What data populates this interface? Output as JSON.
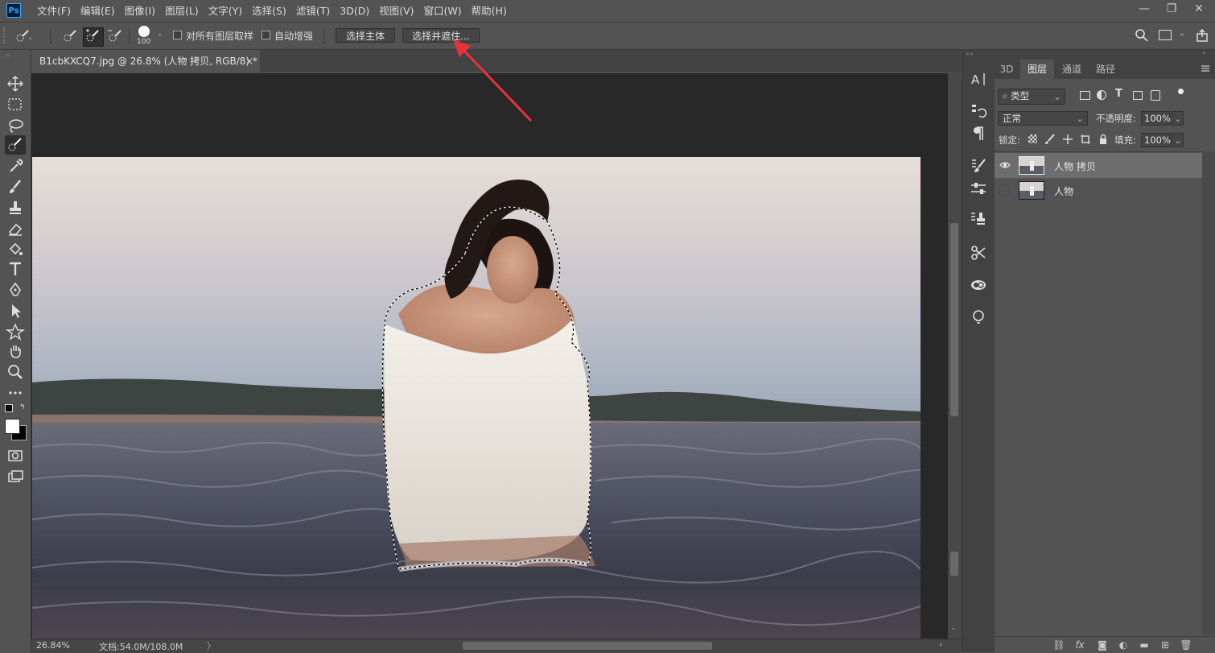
{
  "app": {
    "logo_text": "Ps"
  },
  "menu": [
    "文件(F)",
    "编辑(E)",
    "图像(I)",
    "图层(L)",
    "文字(Y)",
    "选择(S)",
    "滤镜(T)",
    "3D(D)",
    "视图(V)",
    "窗口(W)",
    "帮助(H)"
  ],
  "window_controls": {
    "minimize": "—",
    "restore": "❐",
    "close": "✕"
  },
  "options": {
    "brush_size": "100",
    "sample_all_layers_label": "对所有图层取样",
    "auto_enhance_label": "自动增强",
    "select_subject_label": "选择主体",
    "select_and_mask_label": "选择并遮住..."
  },
  "document": {
    "tab_title": "B1cbKXCQ7.jpg @ 26.8% (人物 拷贝, RGB/8) *",
    "close_glyph": "×",
    "zoom": "26.84%",
    "doc_size": "文档:54.0M/108.0M"
  },
  "panels": {
    "tabs": [
      "3D",
      "图层",
      "通道",
      "路径"
    ],
    "active_tab": "图层",
    "filter_kind": "类型",
    "blend_mode": "正常",
    "opacity_label": "不透明度:",
    "opacity_value": "100%",
    "lock_label": "锁定:",
    "fill_label": "填充:",
    "fill_value": "100%",
    "layers": [
      {
        "name": "人物 拷贝",
        "visible": true,
        "selected": true
      },
      {
        "name": "人物",
        "visible": false,
        "selected": false
      }
    ]
  },
  "colors": {
    "accent": "#31a8ff",
    "annotation_arrow": "#e8323a",
    "ui_bg": "#535353",
    "canvas_bg": "#282828"
  }
}
